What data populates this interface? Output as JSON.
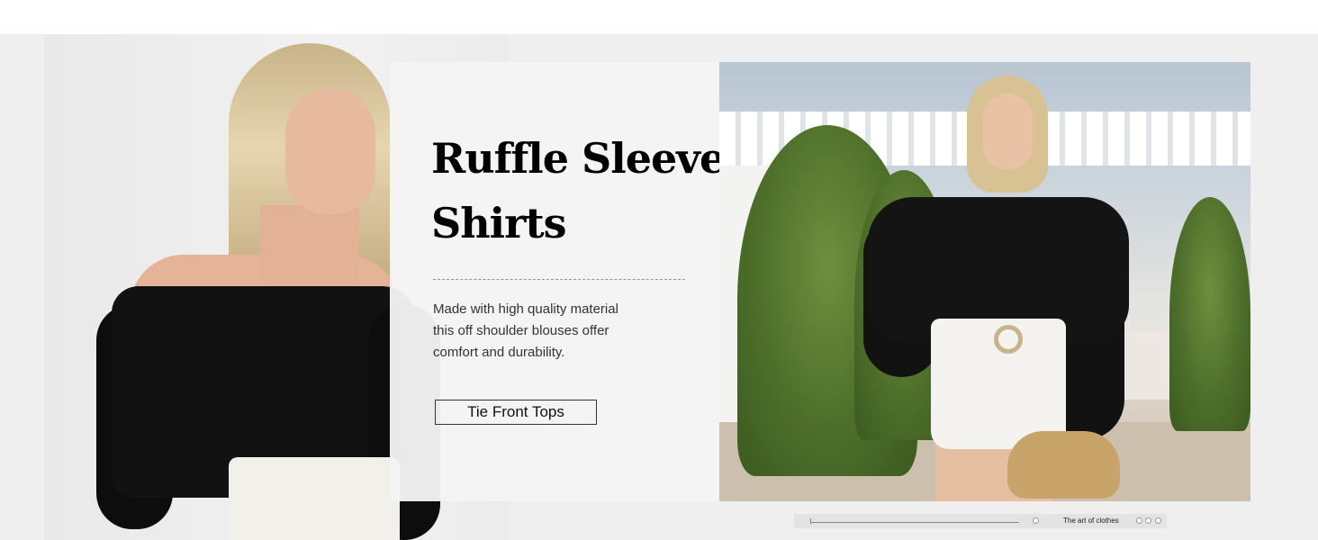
{
  "hero": {
    "headline_line1": "Ruffle Sleeve",
    "headline_line2": "Shirts",
    "description_lines": [
      "Made with high quality material",
      "this off shoulder blouses offer",
      "comfort and durability."
    ],
    "cta_label": "Tie Front Tops"
  },
  "footer_strip": {
    "caption": "The art of clothes"
  },
  "colors": {
    "banner_background": "#efefef",
    "divider": "#b58a6d",
    "text": "#333333",
    "headline": "#000000"
  }
}
